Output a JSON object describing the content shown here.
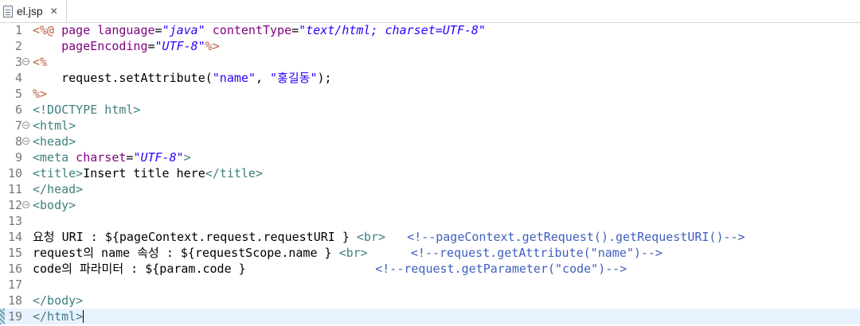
{
  "tab": {
    "label": "el.jsp",
    "close": "✕"
  },
  "editor": {
    "current_line": 19,
    "lines": [
      {
        "num": "1",
        "fold": false,
        "tokens": [
          {
            "t": "<%@",
            "c": "k-dir"
          },
          {
            "t": " page ",
            "c": "k-attr"
          },
          {
            "t": "language",
            "c": "k-attr"
          },
          {
            "t": "=",
            "c": "k-plain"
          },
          {
            "t": "\"java\"",
            "c": "k-val"
          },
          {
            "t": " contentType",
            "c": "k-attr"
          },
          {
            "t": "=",
            "c": "k-plain"
          },
          {
            "t": "\"text/html; charset=UTF-8\"",
            "c": "k-val"
          }
        ]
      },
      {
        "num": "2",
        "fold": false,
        "tokens": [
          {
            "t": "    pageEncoding",
            "c": "k-attr"
          },
          {
            "t": "=",
            "c": "k-plain"
          },
          {
            "t": "\"UTF-8\"",
            "c": "k-val"
          },
          {
            "t": "%>",
            "c": "k-dir"
          }
        ]
      },
      {
        "num": "3",
        "fold": true,
        "tokens": [
          {
            "t": "<%",
            "c": "k-dir"
          }
        ]
      },
      {
        "num": "4",
        "fold": false,
        "tokens": [
          {
            "t": "    request.setAttribute(",
            "c": "k-plain"
          },
          {
            "t": "\"name\"",
            "c": "k-val-plain"
          },
          {
            "t": ", ",
            "c": "k-plain"
          },
          {
            "t": "\"홍길동\"",
            "c": "k-val-plain"
          },
          {
            "t": ");",
            "c": "k-plain"
          }
        ]
      },
      {
        "num": "5",
        "fold": false,
        "tokens": [
          {
            "t": "%>",
            "c": "k-dir"
          }
        ]
      },
      {
        "num": "6",
        "fold": false,
        "tokens": [
          {
            "t": "<!DOCTYPE html>",
            "c": "k-tag"
          }
        ]
      },
      {
        "num": "7",
        "fold": true,
        "tokens": [
          {
            "t": "<html>",
            "c": "k-tag"
          }
        ]
      },
      {
        "num": "8",
        "fold": true,
        "tokens": [
          {
            "t": "<head>",
            "c": "k-tag"
          }
        ]
      },
      {
        "num": "9",
        "fold": false,
        "tokens": [
          {
            "t": "<meta",
            "c": "k-tag"
          },
          {
            "t": " charset",
            "c": "k-attr"
          },
          {
            "t": "=",
            "c": "k-plain"
          },
          {
            "t": "\"UTF-8\"",
            "c": "k-val"
          },
          {
            "t": ">",
            "c": "k-tag"
          }
        ]
      },
      {
        "num": "10",
        "fold": false,
        "tokens": [
          {
            "t": "<title>",
            "c": "k-tag"
          },
          {
            "t": "Insert title here",
            "c": "k-plain"
          },
          {
            "t": "</title>",
            "c": "k-tag"
          }
        ]
      },
      {
        "num": "11",
        "fold": false,
        "tokens": [
          {
            "t": "</head>",
            "c": "k-tag"
          }
        ]
      },
      {
        "num": "12",
        "fold": true,
        "tokens": [
          {
            "t": "<body>",
            "c": "k-tag"
          }
        ]
      },
      {
        "num": "13",
        "fold": false,
        "tokens": []
      },
      {
        "num": "14",
        "fold": false,
        "tokens": [
          {
            "t": "요청 URI : ${pageContext.request.requestURI } ",
            "c": "k-plain"
          },
          {
            "t": "<br>",
            "c": "k-tag"
          },
          {
            "t": "   ",
            "c": "k-plain"
          },
          {
            "t": "<!--pageContext.getRequest().getRequestURI()-->",
            "c": "k-cmt"
          }
        ]
      },
      {
        "num": "15",
        "fold": false,
        "tokens": [
          {
            "t": "request의 name 속성 : ${requestScope.name } ",
            "c": "k-plain"
          },
          {
            "t": "<br>",
            "c": "k-tag"
          },
          {
            "t": "      ",
            "c": "k-plain"
          },
          {
            "t": "<!--request.getAttribute(\"name\")-->",
            "c": "k-cmt"
          }
        ]
      },
      {
        "num": "16",
        "fold": false,
        "tokens": [
          {
            "t": "code의 파라미터 : ${param.code }                  ",
            "c": "k-plain"
          },
          {
            "t": "<!--request.getParameter(\"code\")-->",
            "c": "k-cmt"
          }
        ]
      },
      {
        "num": "17",
        "fold": false,
        "tokens": []
      },
      {
        "num": "18",
        "fold": false,
        "tokens": [
          {
            "t": "</body>",
            "c": "k-tag"
          }
        ]
      },
      {
        "num": "19",
        "fold": false,
        "tokens": [
          {
            "t": "</html>",
            "c": "k-tag"
          }
        ]
      }
    ]
  },
  "colors": {
    "directive": "#bf5f3f",
    "tag": "#3f7f7f",
    "attribute": "#7f007f",
    "attr_value": "#2a00ff",
    "comment": "#3f5fbf",
    "current_line_bg": "#e8f2fe"
  },
  "icons": {
    "tab_icon": "jsp-file-icon",
    "close_icon": "close-icon",
    "fold_icon": "collapse-icon"
  }
}
